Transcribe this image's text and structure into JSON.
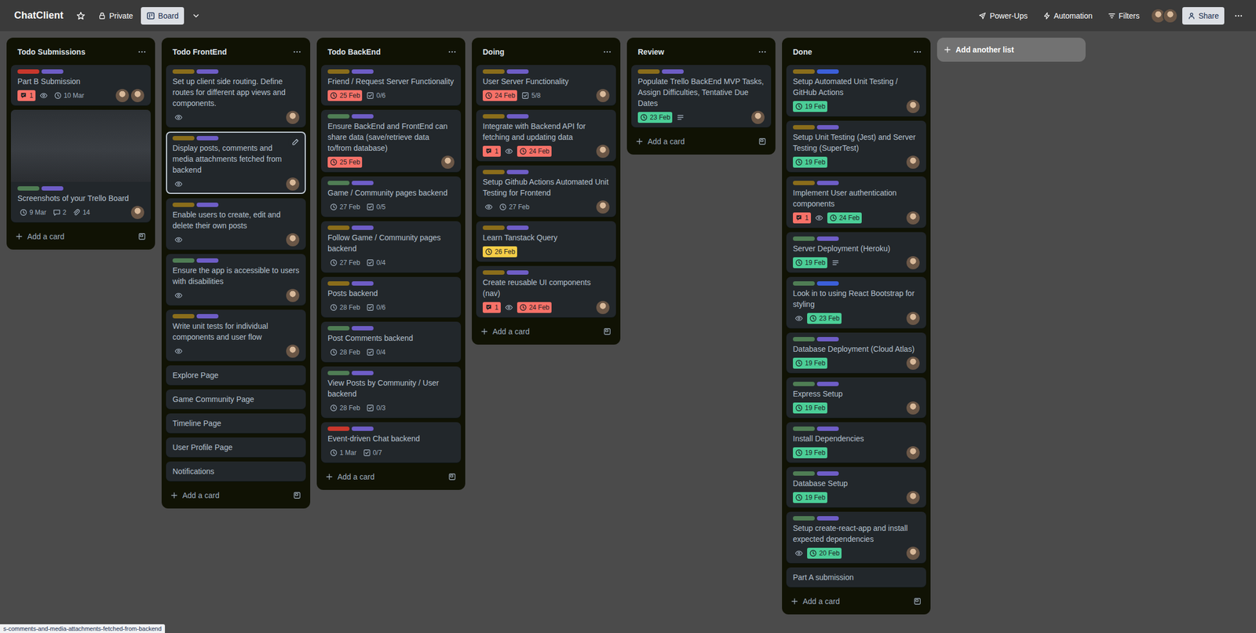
{
  "board": {
    "title": "ChatClient",
    "starred": false,
    "visibility": "Private",
    "views": [
      {
        "label": "Board",
        "selected": true
      }
    ]
  },
  "header_actions": [
    {
      "label": "Power-Ups",
      "kind": "powerups"
    },
    {
      "label": "Automation",
      "kind": "automation"
    },
    {
      "label": "Filters",
      "kind": "filters"
    }
  ],
  "members": 2,
  "share": "Share",
  "lists": [
    {
      "title": "Todo Submissions",
      "add_card": "Add a card",
      "cards": [
        {
          "title": "Part B Submission",
          "labels": [
            {
              "color": "#c9372c"
            },
            {
              "color": "#6e5dc6"
            }
          ],
          "badges": [
            {
              "kind": "notifications",
              "text": "1"
            },
            {
              "kind": "watch"
            },
            {
              "kind": "due",
              "text": "10 Mar",
              "status": "upcoming"
            }
          ],
          "avatars": 2,
          "selected": false
        },
        {
          "title": "Screenshots of your Trello Board",
          "cover": true,
          "labels": [
            {
              "color": "#4f7d54"
            },
            {
              "color": "#6e5dc6"
            }
          ],
          "badges": [
            {
              "kind": "due",
              "text": "9 Mar",
              "status": "upcoming"
            },
            {
              "kind": "comments",
              "text": "2"
            },
            {
              "kind": "attachments",
              "text": "14"
            }
          ],
          "avatars": 1,
          "selected": false
        }
      ]
    },
    {
      "title": "Todo FrontEnd",
      "add_card": "Add a card",
      "cards": [
        {
          "title": "Set up client side routing. Define routes for different app views and components.",
          "labels": [
            {
              "color": "#8a6d1b"
            },
            {
              "color": "#6e5dc6"
            }
          ],
          "badges": [
            {
              "kind": "watch"
            }
          ],
          "avatars": 1,
          "selected": false
        },
        {
          "title": "Display posts, comments and media attachments fetched from backend",
          "labels": [
            {
              "color": "#8a6d1b"
            },
            {
              "color": "#6e5dc6"
            }
          ],
          "badges": [
            {
              "kind": "watch"
            }
          ],
          "avatars": 1,
          "selected": true
        },
        {
          "title": "Enable users to create, edit and delete their own posts",
          "labels": [
            {
              "color": "#8a6d1b"
            },
            {
              "color": "#6e5dc6"
            }
          ],
          "badges": [
            {
              "kind": "watch"
            }
          ],
          "avatars": 1,
          "selected": false
        },
        {
          "title": "Ensure the app is accessible to users with disabilities",
          "labels": [
            {
              "color": "#4f7d54"
            },
            {
              "color": "#6e5dc6"
            }
          ],
          "badges": [
            {
              "kind": "watch"
            }
          ],
          "avatars": 1,
          "selected": false
        },
        {
          "title": "Write unit tests for individual components and user flow",
          "labels": [
            {
              "color": "#8a6d1b"
            },
            {
              "color": "#6e5dc6"
            }
          ],
          "badges": [
            {
              "kind": "watch"
            }
          ],
          "avatars": 1,
          "selected": false
        },
        {
          "title": "Explore Page",
          "selected": false
        },
        {
          "title": "Game Community Page",
          "selected": false
        },
        {
          "title": "Timeline Page",
          "selected": false
        },
        {
          "title": "User Profile Page",
          "selected": false
        },
        {
          "title": "Notifications",
          "selected": false
        }
      ]
    },
    {
      "title": "Todo BackEnd",
      "add_card": "Add a card",
      "cards": [
        {
          "title": "Friend / Request Server Functionality",
          "labels": [
            {
              "color": "#8a6d1b"
            },
            {
              "color": "#6e5dc6"
            }
          ],
          "badges": [
            {
              "kind": "due",
              "text": "25 Feb",
              "status": "overdue"
            },
            {
              "kind": "checklist",
              "text": "0/6"
            }
          ],
          "selected": false
        },
        {
          "title": "Ensure BackEnd and FrontEnd can share data (save/retrieve data to/from database)",
          "labels": [
            {
              "color": "#4f7d54"
            },
            {
              "color": "#6e5dc6"
            }
          ],
          "badges": [
            {
              "kind": "due",
              "text": "25 Feb",
              "status": "overdue"
            }
          ],
          "avatars": 1,
          "selected": false
        },
        {
          "title": "Game / Community pages backend",
          "labels": [
            {
              "color": "#4f7d54"
            },
            {
              "color": "#6e5dc6"
            }
          ],
          "badges": [
            {
              "kind": "due",
              "text": "27 Feb",
              "status": "upcoming"
            },
            {
              "kind": "checklist",
              "text": "0/5"
            }
          ],
          "selected": false
        },
        {
          "title": "Follow Game / Community pages backend",
          "labels": [
            {
              "color": "#8a6d1b"
            },
            {
              "color": "#6e5dc6"
            }
          ],
          "badges": [
            {
              "kind": "due",
              "text": "27 Feb",
              "status": "upcoming"
            },
            {
              "kind": "checklist",
              "text": "0/4"
            }
          ],
          "selected": false
        },
        {
          "title": "Posts backend",
          "labels": [
            {
              "color": "#8a6d1b"
            },
            {
              "color": "#6e5dc6"
            }
          ],
          "badges": [
            {
              "kind": "due",
              "text": "28 Feb",
              "status": "upcoming"
            },
            {
              "kind": "checklist",
              "text": "0/6"
            }
          ],
          "selected": false
        },
        {
          "title": "Post Comments backend",
          "labels": [
            {
              "color": "#4f7d54"
            },
            {
              "color": "#6e5dc6"
            }
          ],
          "badges": [
            {
              "kind": "due",
              "text": "28 Feb",
              "status": "upcoming"
            },
            {
              "kind": "checklist",
              "text": "0/4"
            }
          ],
          "selected": false
        },
        {
          "title": "View Posts by Community / User backend",
          "labels": [
            {
              "color": "#4f7d54"
            },
            {
              "color": "#6e5dc6"
            }
          ],
          "badges": [
            {
              "kind": "due",
              "text": "28 Feb",
              "status": "upcoming"
            },
            {
              "kind": "checklist",
              "text": "0/3"
            }
          ],
          "selected": false
        },
        {
          "title": "Event-driven Chat backend",
          "labels": [
            {
              "color": "#c9372c"
            },
            {
              "color": "#6e5dc6"
            }
          ],
          "badges": [
            {
              "kind": "due",
              "text": "1 Mar",
              "status": "upcoming"
            },
            {
              "kind": "checklist",
              "text": "0/7"
            }
          ],
          "selected": false
        }
      ]
    },
    {
      "title": "Doing",
      "add_card": "Add a card",
      "cards": [
        {
          "title": "User Server Functionality",
          "labels": [
            {
              "color": "#8a6d1b"
            },
            {
              "color": "#6e5dc6"
            }
          ],
          "badges": [
            {
              "kind": "due",
              "text": "24 Feb",
              "status": "overdue"
            },
            {
              "kind": "checklist",
              "text": "5/8"
            }
          ],
          "avatars": 1,
          "selected": false
        },
        {
          "title": "Integrate with Backend API for fetching and updating data",
          "labels": [
            {
              "color": "#8a6d1b"
            },
            {
              "color": "#6e5dc6"
            }
          ],
          "badges": [
            {
              "kind": "notifications",
              "text": "1"
            },
            {
              "kind": "watch"
            },
            {
              "kind": "due",
              "text": "24 Feb",
              "status": "overdue"
            }
          ],
          "avatars": 1,
          "selected": false
        },
        {
          "title": "Setup Github Actions Automated Unit Testing for Frontend",
          "labels": [
            {
              "color": "#8a6d1b"
            },
            {
              "color": "#6e5dc6"
            }
          ],
          "badges": [
            {
              "kind": "watch"
            },
            {
              "kind": "due",
              "text": "27 Feb",
              "status": "upcoming"
            }
          ],
          "avatars": 1,
          "selected": false
        },
        {
          "title": "Learn Tanstack Query",
          "labels": [
            {
              "color": "#8a6d1b"
            },
            {
              "color": "#6e5dc6"
            }
          ],
          "badges": [
            {
              "kind": "due",
              "text": "26 Feb",
              "status": "due-soon"
            }
          ],
          "selected": false
        },
        {
          "title": "Create reusable UI components (nav)",
          "labels": [
            {
              "color": "#8a6d1b"
            },
            {
              "color": "#6e5dc6"
            }
          ],
          "badges": [
            {
              "kind": "notifications",
              "text": "1"
            },
            {
              "kind": "watch"
            },
            {
              "kind": "due",
              "text": "24 Feb",
              "status": "overdue"
            }
          ],
          "avatars": 1,
          "selected": false
        }
      ]
    },
    {
      "title": "Review",
      "add_card": "Add a card",
      "cards": [
        {
          "title": "Populate Trello BackEnd MVP Tasks, Assign Difficulties, Tentative Due Dates",
          "labels": [
            {
              "color": "#8a6d1b"
            },
            {
              "color": "#6e5dc6"
            }
          ],
          "badges": [
            {
              "kind": "due",
              "text": "23 Feb",
              "status": "complete"
            },
            {
              "kind": "description"
            }
          ],
          "avatars": 1,
          "selected": false
        }
      ]
    },
    {
      "title": "Done",
      "add_card": "Add a card",
      "cards": [
        {
          "title": "Setup Automated Unit Testing / GitHub Actions",
          "labels": [
            {
              "color": "#8a6d1b"
            },
            {
              "color": "#3b5fd9"
            }
          ],
          "badges": [
            {
              "kind": "due",
              "text": "19 Feb",
              "status": "complete"
            }
          ],
          "avatars": 1,
          "selected": false
        },
        {
          "title": "Setup Unit Testing (Jest) and Server Testing (SuperTest)",
          "labels": [
            {
              "color": "#8a6d1b"
            },
            {
              "color": "#6e5dc6"
            }
          ],
          "badges": [
            {
              "kind": "due",
              "text": "19 Feb",
              "status": "complete"
            }
          ],
          "avatars": 1,
          "selected": false
        },
        {
          "title": "Implement User authentication components",
          "labels": [
            {
              "color": "#8a6d1b"
            },
            {
              "color": "#6e5dc6"
            }
          ],
          "badges": [
            {
              "kind": "notifications",
              "text": "1"
            },
            {
              "kind": "watch"
            },
            {
              "kind": "due",
              "text": "24 Feb",
              "status": "complete"
            }
          ],
          "avatars": 1,
          "selected": false
        },
        {
          "title": "Server Deployment (Heroku)",
          "labels": [
            {
              "color": "#4f7d54"
            },
            {
              "color": "#6e5dc6"
            }
          ],
          "badges": [
            {
              "kind": "due",
              "text": "19 Feb",
              "status": "complete"
            },
            {
              "kind": "description"
            }
          ],
          "avatars": 1,
          "selected": false
        },
        {
          "title": "Look in to using React Bootstrap for styling",
          "labels": [
            {
              "color": "#4f7d54"
            },
            {
              "color": "#3b5fd9"
            }
          ],
          "badges": [
            {
              "kind": "watch"
            },
            {
              "kind": "due",
              "text": "23 Feb",
              "status": "complete"
            }
          ],
          "avatars": 1,
          "selected": false
        },
        {
          "title": "Database Deployment (Cloud Atlas)",
          "labels": [
            {
              "color": "#4f7d54"
            },
            {
              "color": "#6e5dc6"
            }
          ],
          "badges": [
            {
              "kind": "due",
              "text": "19 Feb",
              "status": "complete"
            }
          ],
          "avatars": 1,
          "selected": false
        },
        {
          "title": "Express Setup",
          "labels": [
            {
              "color": "#4f7d54"
            },
            {
              "color": "#6e5dc6"
            }
          ],
          "badges": [
            {
              "kind": "due",
              "text": "19 Feb",
              "status": "complete"
            }
          ],
          "avatars": 1,
          "selected": false
        },
        {
          "title": "Install Dependencies",
          "labels": [
            {
              "color": "#4f7d54"
            },
            {
              "color": "#6e5dc6"
            }
          ],
          "badges": [
            {
              "kind": "due",
              "text": "19 Feb",
              "status": "complete"
            }
          ],
          "avatars": 1,
          "selected": false
        },
        {
          "title": "Database Setup",
          "labels": [
            {
              "color": "#4f7d54"
            },
            {
              "color": "#6e5dc6"
            }
          ],
          "badges": [
            {
              "kind": "due",
              "text": "19 Feb",
              "status": "complete"
            }
          ],
          "avatars": 1,
          "selected": false
        },
        {
          "title": "Setup create-react-app and install expected dependencies",
          "labels": [
            {
              "color": "#4f7d54"
            },
            {
              "color": "#6e5dc6"
            }
          ],
          "badges": [
            {
              "kind": "watch"
            },
            {
              "kind": "due",
              "text": "20 Feb",
              "status": "complete"
            }
          ],
          "avatars": 1,
          "selected": false
        },
        {
          "title": "Part A submission",
          "selected": false
        }
      ]
    }
  ],
  "add_list": "Add another list",
  "status_bar": "s-comments-and-media-attachments-fetched-from-backend"
}
